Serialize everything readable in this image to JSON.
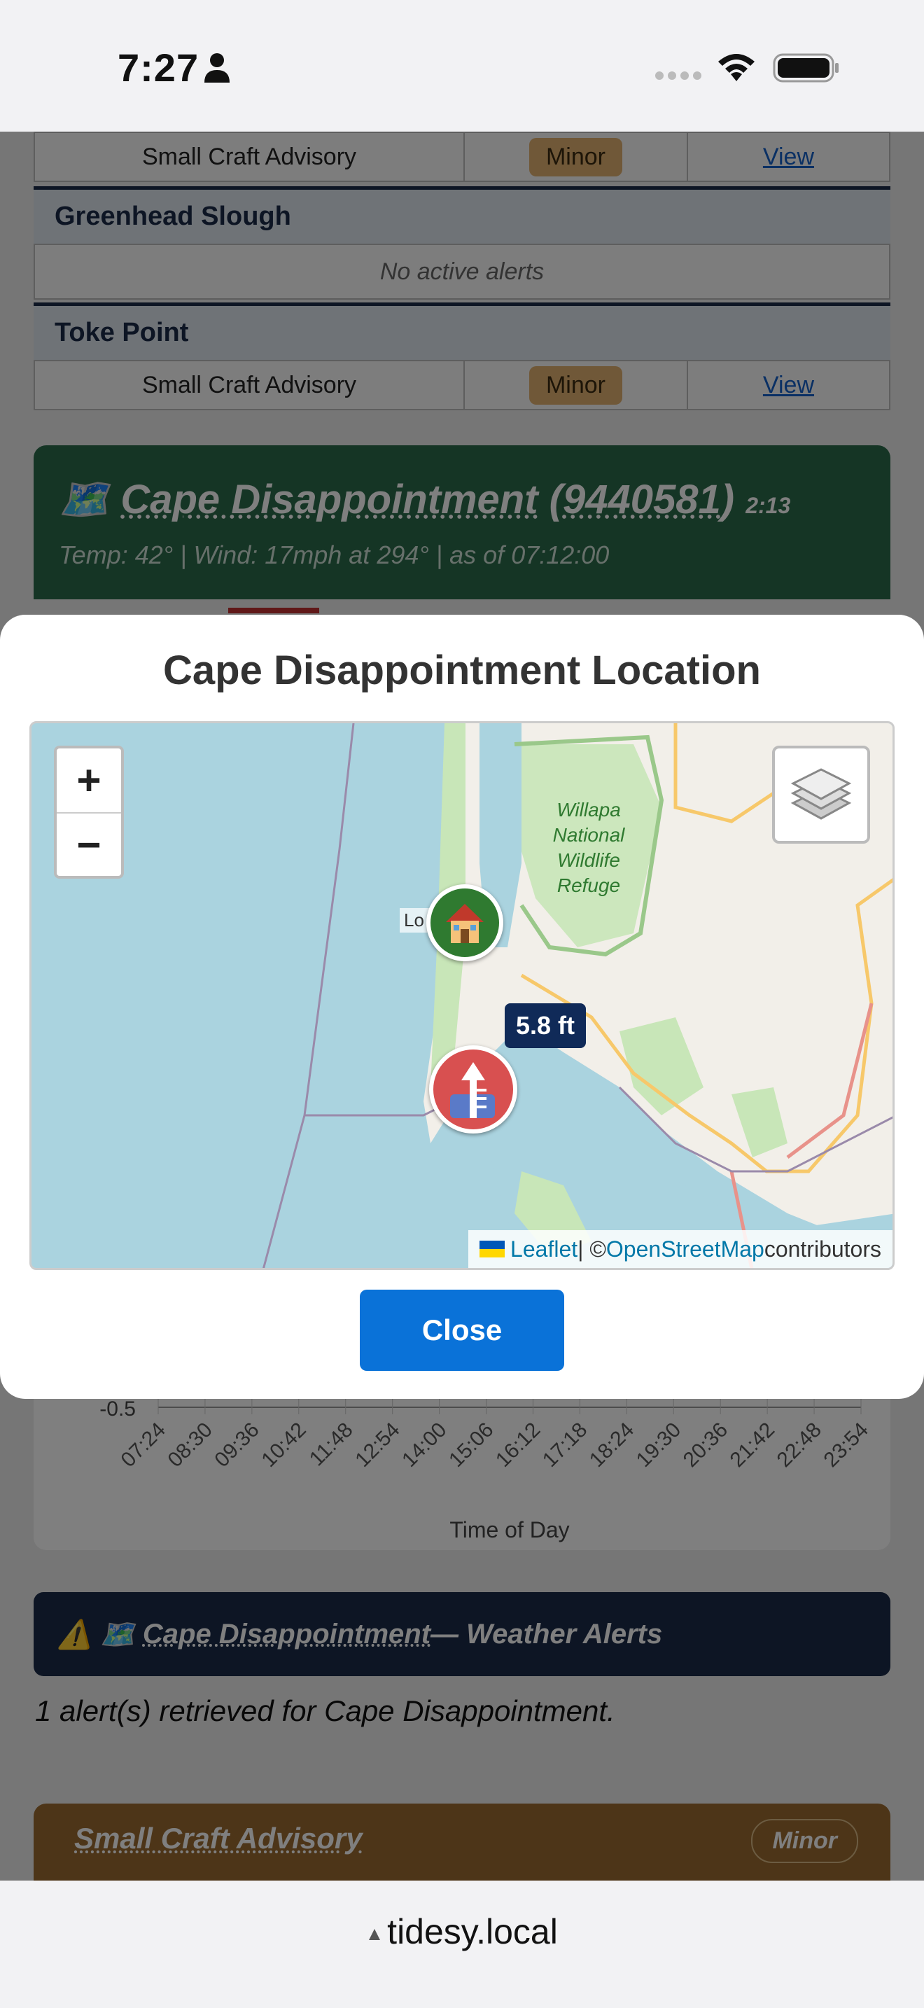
{
  "status_bar": {
    "time": "7:27"
  },
  "alerts_table": {
    "row_top": {
      "alert": "Small Craft Advisory",
      "severity": "Minor",
      "link": "View"
    },
    "greenhead": {
      "name": "Greenhead Slough",
      "empty": "No active alerts"
    },
    "toke": {
      "name": "Toke Point",
      "alert": "Small Craft Advisory",
      "severity": "Minor",
      "link": "View"
    }
  },
  "station": {
    "name": "Cape Disappointment",
    "id": "9440581",
    "time": "2:13",
    "meta": "Temp: 42° | Wind: 17mph at 294° | as of 07:12:00"
  },
  "chart_data": {
    "type": "line",
    "xlabel": "Time of Day",
    "ylabel": "",
    "y_tick_visible": "-0.5",
    "categories": [
      "07:24",
      "08:30",
      "09:36",
      "10:42",
      "11:48",
      "12:54",
      "14:00",
      "15:06",
      "16:12",
      "17:18",
      "18:24",
      "19:30",
      "20:36",
      "21:42",
      "22:48",
      "23:54"
    ]
  },
  "weather": {
    "banner_name": "Cape Disappointment",
    "banner_suffix": " — Weather Alerts",
    "count_text": "1 alert(s) retrieved for Cape Disappointment.",
    "advisory_title": "Small Craft Advisory",
    "advisory_badge": "Minor"
  },
  "modal": {
    "title": "Cape Disappointment Location",
    "zoom_in": "+",
    "zoom_out": "−",
    "tide_label": "5.8 ft",
    "location_label_left": "Lo",
    "location_label_right": "h",
    "refuge_label": "Willapa National Wildlife Refuge",
    "attribution": {
      "leaflet": "Leaflet",
      "sep": " | © ",
      "osm": "OpenStreetMap",
      "suffix": " contributors"
    },
    "close_label": "Close"
  },
  "browser": {
    "url": "tidesy.local"
  },
  "colors": {
    "accent": "#0a72d8",
    "station_card": "#2a6a4a",
    "banner": "#1a2a48",
    "advisory": "#9a6a30"
  }
}
